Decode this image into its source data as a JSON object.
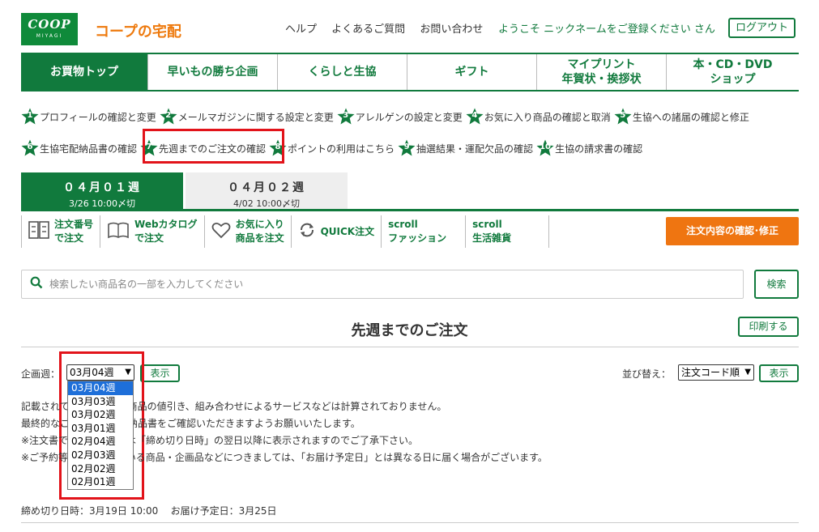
{
  "header": {
    "logo_line1": "COOP",
    "logo_line2": "MIYAGI",
    "brand": "コープの宅配",
    "links": [
      "ヘルプ",
      "よくあるご質問",
      "お問い合わせ"
    ],
    "welcome": "ようこそ ニックネームをご登録ください さん",
    "logout": "ログアウト"
  },
  "nav": {
    "tabs": [
      {
        "line1": "お買物トップ",
        "line2": ""
      },
      {
        "line1": "早いもの勝ち企画",
        "line2": ""
      },
      {
        "line1": "くらしと生協",
        "line2": ""
      },
      {
        "line1": "ギフト",
        "line2": ""
      },
      {
        "line1": "マイプリント",
        "line2": "年賀状・挨拶状"
      },
      {
        "line1": "本・CD・DVD",
        "line2": "ショップ"
      }
    ]
  },
  "steps": [
    {
      "num": "1",
      "label": "プロフィールの確認と変更"
    },
    {
      "num": "2",
      "label": "メールマガジンに関する設定と変更"
    },
    {
      "num": "3",
      "label": "アレルゲンの設定と変更"
    },
    {
      "num": "4",
      "label": "お気に入り商品の確認と取消"
    },
    {
      "num": "5",
      "label": "生協への諸届の確認と修正"
    },
    {
      "num": "6",
      "label": "生協宅配納品書の確認"
    },
    {
      "num": "7",
      "label": "先週までのご注文の確認"
    },
    {
      "num": "8",
      "label": "ポイントの利用はこちら"
    },
    {
      "num": "9",
      "label": "抽選結果・運配欠品の確認"
    },
    {
      "num": "10",
      "label": "生協の請求書の確認"
    }
  ],
  "weeks": [
    {
      "label": "０４月０１週",
      "deadline": "3/26 10:00〆切"
    },
    {
      "label": "０４月０２週",
      "deadline": "4/02 10:00〆切"
    }
  ],
  "tools": [
    {
      "line1": "注文番号",
      "line2": "で注文",
      "icon": "order-number-icon"
    },
    {
      "line1": "Webカタログ",
      "line2": "で注文",
      "icon": "catalog-book-icon"
    },
    {
      "line1": "お気に入り",
      "line2": "商品を注文",
      "icon": "heart-icon"
    },
    {
      "line1": "QUICK注文",
      "line2": "",
      "icon": "refresh-icon"
    },
    {
      "line1": "scroll",
      "line2": "ファッション",
      "icon": ""
    },
    {
      "line1": "scroll",
      "line2": "生活雑貨",
      "icon": ""
    }
  ],
  "confirm_button": "注文内容の確認･修正",
  "search": {
    "placeholder": "検索したい商品名の一部を入力してください",
    "button": "検索"
  },
  "page_title": "先週までのご注文",
  "print_button": "印刷する",
  "filter": {
    "week_label": "企画週：",
    "week_selected": "03月04週",
    "show_button": "表示",
    "sort_label": "並び替え：",
    "sort_selected": "注文コード順",
    "sort_show_button": "表示"
  },
  "dropdown_options": [
    "03月04週",
    "03月03週",
    "03月02週",
    "03月01週",
    "02月04週",
    "02月03週",
    "02月02週",
    "02月01週"
  ],
  "notes": [
    "記載されている金額は、商品の値引き、組み合わせによるサービスなどは計算されておりません。",
    "最終的なご請求金額は、納品書をご確認いただきますようお願いいたします。",
    "※注文書でのご注文内容は「締め切り日時」の翌日以降に表示されますのでご了承下さい。",
    "※ご予約等で指定されている商品・企画品などにつきましては、「お届け予定日」とは異なる日に届く場合がございます。"
  ],
  "deadline": {
    "cutoff": "締め切り日時：3月19日 10:00",
    "delivery": "お届け予定日：3月25日"
  },
  "colors": {
    "green": "#117a3d",
    "orange": "#ef7511",
    "brand_orange": "#ee7a0e",
    "highlight_red": "#e2131a"
  }
}
